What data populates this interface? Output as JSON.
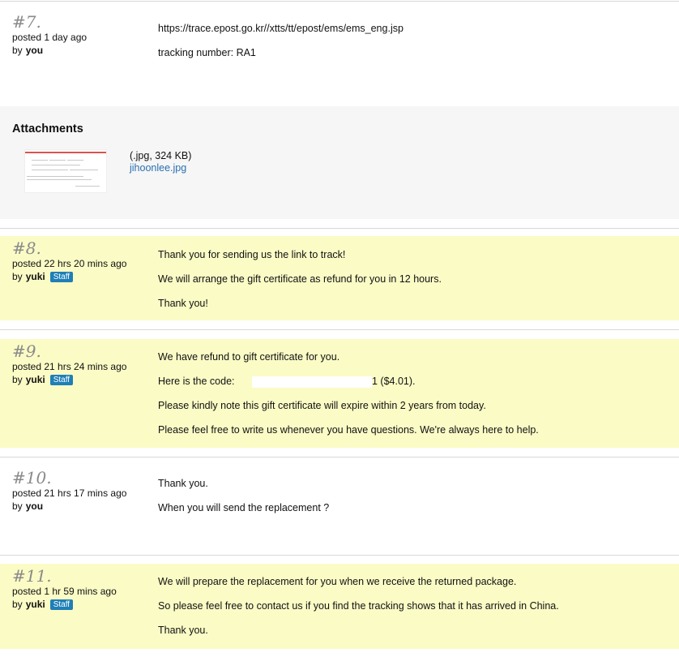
{
  "messages": {
    "m7": {
      "number": "#7.",
      "posted": "posted 1 day ago",
      "by_prefix": "by",
      "author": "you",
      "lines": [
        "https://trace.epost.go.kr//xtts/tt/epost/ems/ems_eng.jsp",
        "tracking number: RA1"
      ]
    },
    "m8": {
      "number": "#8.",
      "posted": "posted 22 hrs 20 mins ago",
      "by_prefix": "by",
      "author": "yuki",
      "badge": "Staff",
      "lines": [
        "Thank you for sending us the link to track!",
        "We will arrange the gift certificate as refund for you in 12 hours.",
        "Thank you!"
      ]
    },
    "m9": {
      "number": "#9.",
      "posted": "posted 21 hrs 24 mins ago",
      "by_prefix": "by",
      "author": "yuki",
      "badge": "Staff",
      "line1": "We have refund to gift certificate for you.",
      "code_prefix": "Here is the code:",
      "code_suffix": "1 ($4.01).",
      "line3": "Please kindly note this gift certificate will expire within 2 years from today.",
      "line4": "Please feel free to write us whenever you have questions. We're always here to help."
    },
    "m10": {
      "number": "#10.",
      "posted": "posted 21 hrs 17 mins ago",
      "by_prefix": "by",
      "author": "you",
      "lines": [
        "Thank you.",
        "When you will send the replacement ?"
      ]
    },
    "m11": {
      "number": "#11.",
      "posted": "posted 1 hr 59 mins ago",
      "by_prefix": "by",
      "author": "yuki",
      "badge": "Staff",
      "lines": [
        "We will prepare the replacement for you when we receive the returned package.",
        "So please feel free to contact us if you find the tracking shows that it has arrived in China.",
        "Thank you."
      ]
    }
  },
  "attachments": {
    "heading": "Attachments",
    "file_meta": "(.jpg, 324 KB)",
    "file_name": "jihoonlee.jpg"
  },
  "colors": {
    "staff_background": "#fbfbc6",
    "attachments_background": "#f6f6f6",
    "staff_badge": "#1f7fb6",
    "link": "#2a6fb0"
  }
}
